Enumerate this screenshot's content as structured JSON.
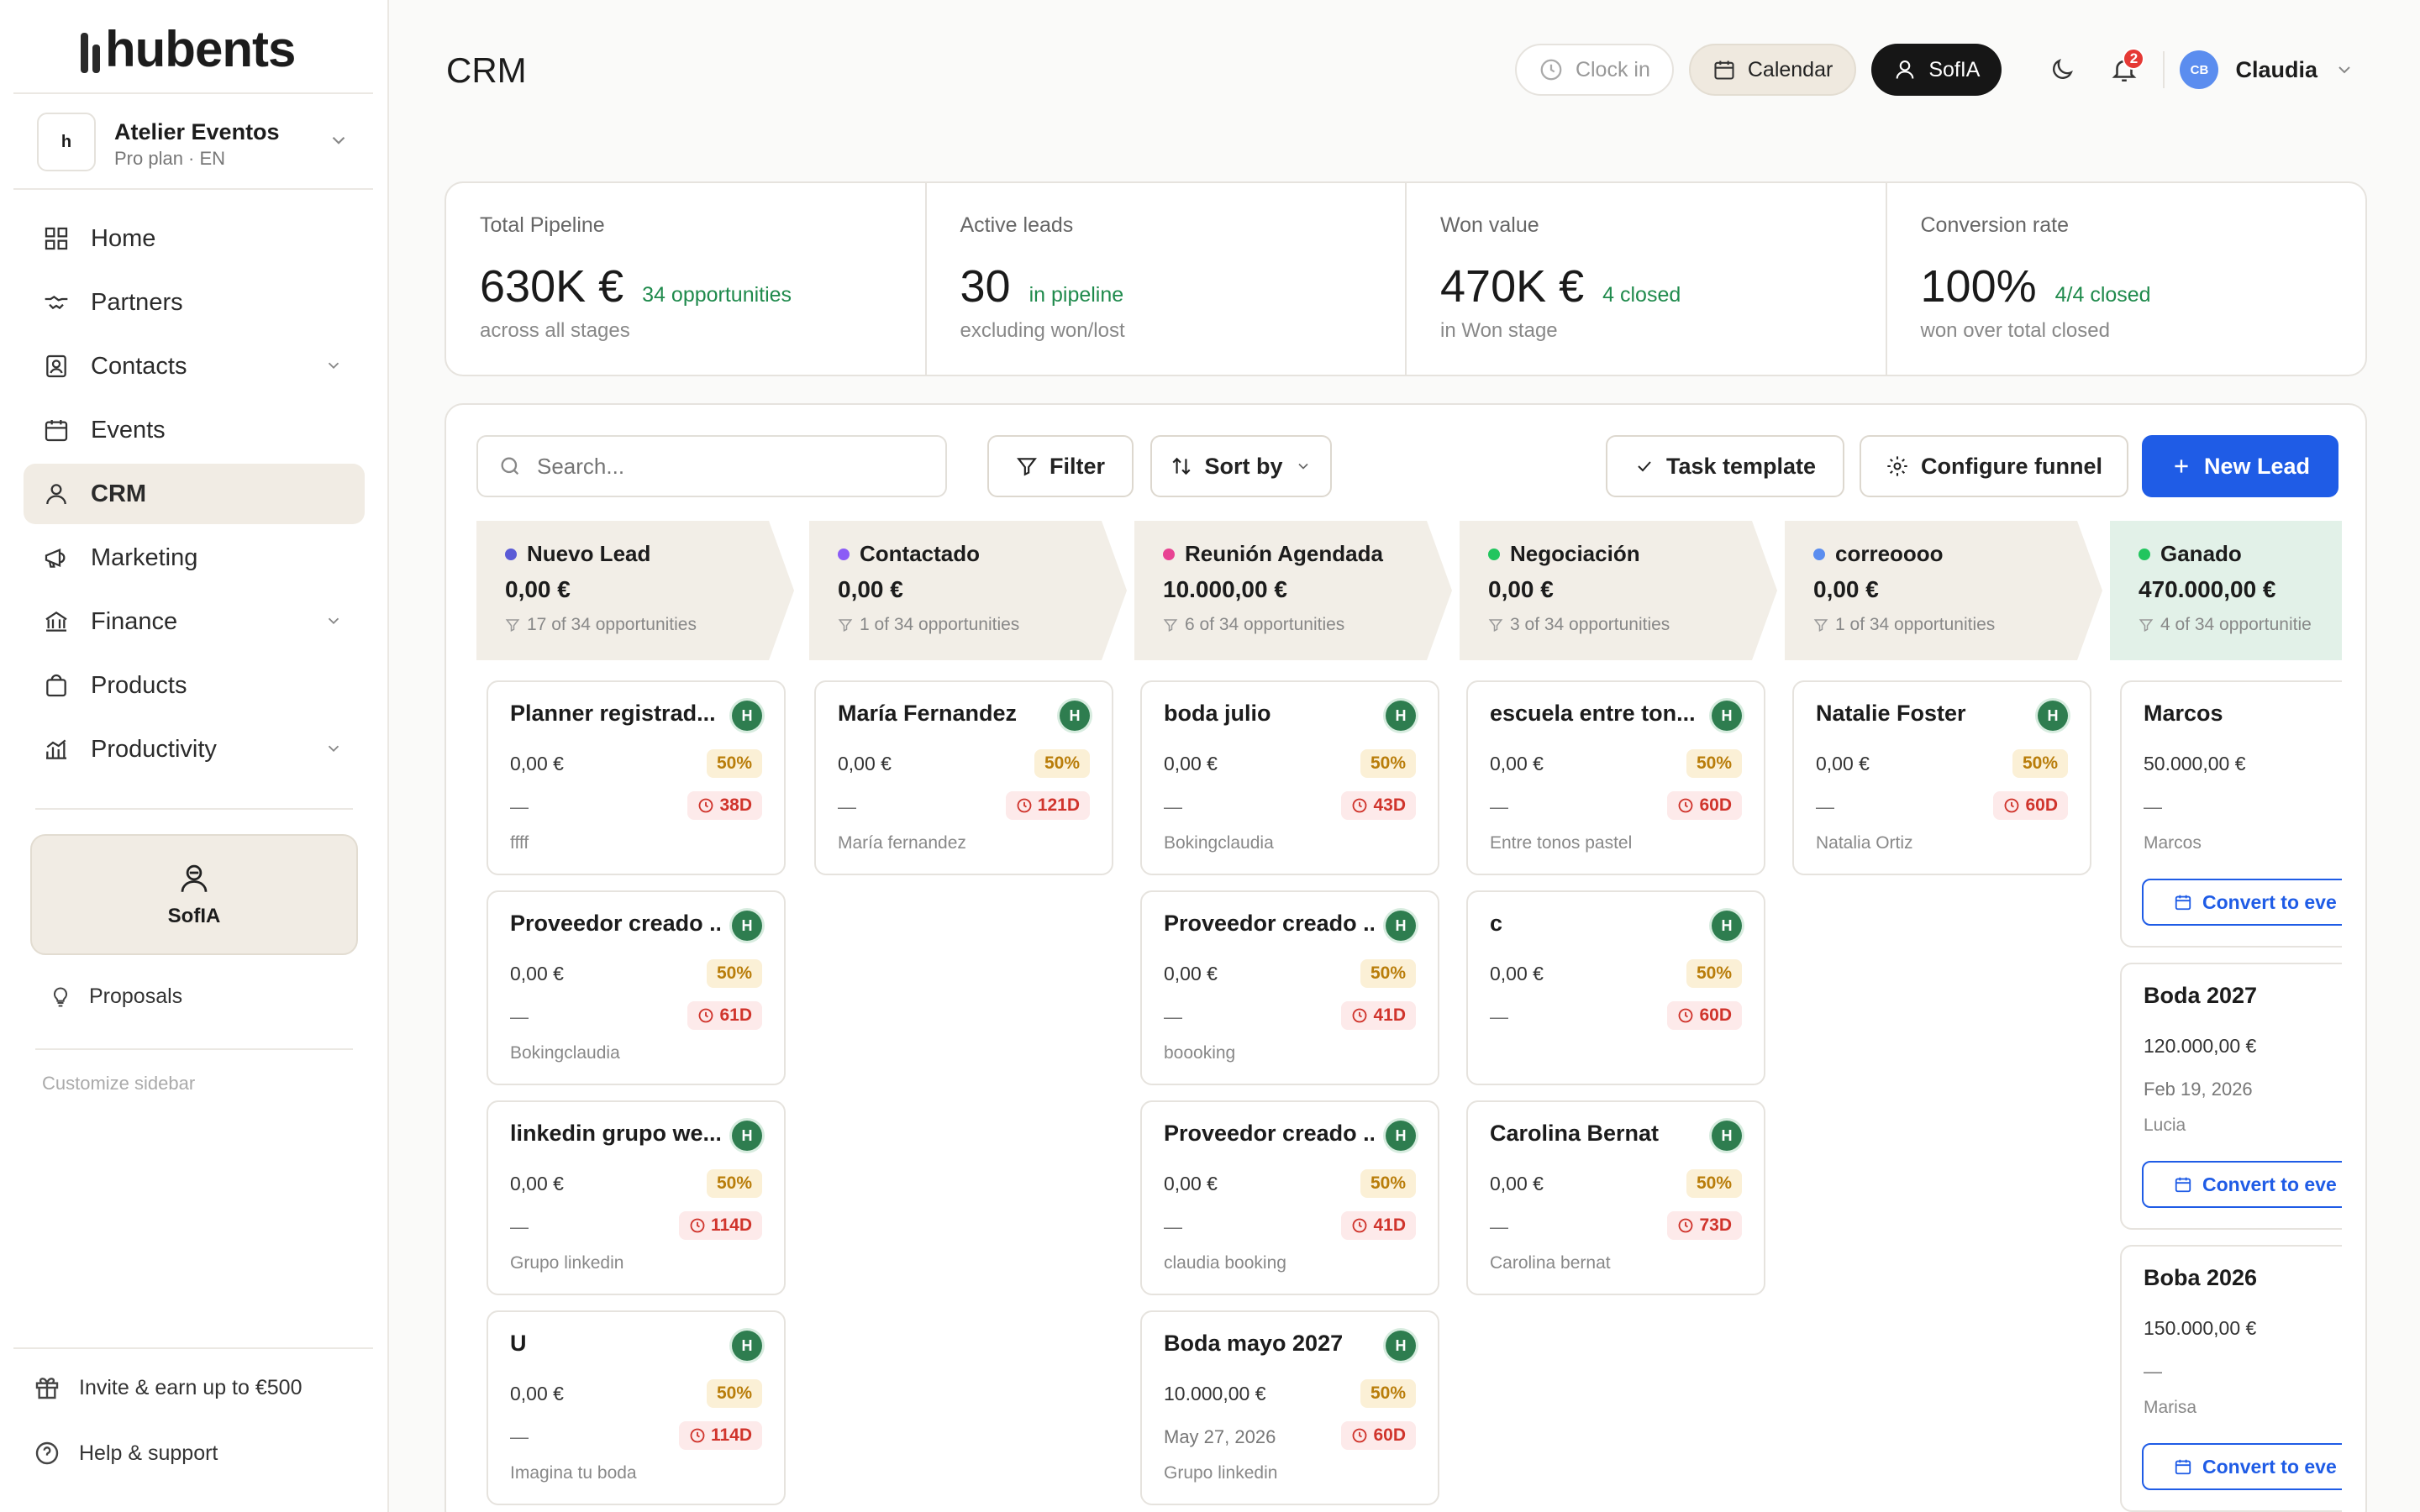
{
  "brand": {
    "name": "hubents"
  },
  "workspace": {
    "initial": "h",
    "name": "Atelier Eventos",
    "plan": "Pro plan · EN"
  },
  "nav": [
    {
      "label": "Home",
      "icon": "home-icon",
      "chevron": false,
      "active": false
    },
    {
      "label": "Partners",
      "icon": "handshake-icon",
      "chevron": false,
      "active": false
    },
    {
      "label": "Contacts",
      "icon": "contacts-icon",
      "chevron": true,
      "active": false
    },
    {
      "label": "Events",
      "icon": "calendar-icon",
      "chevron": false,
      "active": false
    },
    {
      "label": "CRM",
      "icon": "user-icon",
      "chevron": false,
      "active": true
    },
    {
      "label": "Marketing",
      "icon": "megaphone-icon",
      "chevron": false,
      "active": false
    },
    {
      "label": "Finance",
      "icon": "bank-icon",
      "chevron": true,
      "active": false
    },
    {
      "label": "Products",
      "icon": "bag-icon",
      "chevron": false,
      "active": false
    },
    {
      "label": "Productivity",
      "icon": "chart-icon",
      "chevron": true,
      "active": false
    }
  ],
  "sofia_panel": {
    "label": "SofIA"
  },
  "proposals": {
    "label": "Proposals"
  },
  "customize": {
    "label": "Customize sidebar"
  },
  "invite": {
    "label": "Invite & earn up to €500"
  },
  "help": {
    "label": "Help & support"
  },
  "header": {
    "title": "CRM",
    "clock_in": "Clock in",
    "calendar": "Calendar",
    "sofia": "SofIA",
    "notifications": "2",
    "user_initials": "CB",
    "user_name": "Claudia"
  },
  "stats": [
    {
      "label": "Total Pipeline",
      "value": "630K €",
      "accent": "34 opportunities",
      "sub": "across all stages"
    },
    {
      "label": "Active leads",
      "value": "30",
      "accent": "in pipeline",
      "sub": "excluding won/lost"
    },
    {
      "label": "Won value",
      "value": "470K €",
      "accent": "4 closed",
      "sub": "in Won stage"
    },
    {
      "label": "Conversion rate",
      "value": "100%",
      "accent": "4/4 closed",
      "sub": "won over total closed"
    }
  ],
  "toolbar": {
    "search_placeholder": "Search...",
    "filter": "Filter",
    "sort": "Sort by",
    "task_template": "Task template",
    "configure_funnel": "Configure funnel",
    "new_lead": "New Lead"
  },
  "colors": {
    "accent": "#1f5ce6",
    "green": "#1f8a4c",
    "danger": "#d0342c"
  },
  "stages": [
    {
      "name": "Nuevo Lead",
      "dot": "#5b5bd6",
      "value": "0,00 €",
      "count": "17 of 34 opportunities"
    },
    {
      "name": "Contactado",
      "dot": "#8b5cf6",
      "value": "0,00 €",
      "count": "1 of 34 opportunities"
    },
    {
      "name": "Reunión Agendada",
      "dot": "#e84393",
      "value": "10.000,00 €",
      "count": "6 of 34 opportunities"
    },
    {
      "name": "Negociación",
      "dot": "#22c55e",
      "value": "0,00 €",
      "count": "3 of 34 opportunities"
    },
    {
      "name": "correoooo",
      "dot": "#5b8def",
      "value": "0,00 €",
      "count": "1 of 34 opportunities"
    },
    {
      "name": "Ganado",
      "dot": "#22c55e",
      "value": "470.000,00 €",
      "count": "4 of 34 opportunitie"
    }
  ],
  "cards": [
    [
      {
        "title": "Planner registrad...",
        "amount": "0,00 €",
        "pct": "50%",
        "date": "—",
        "age": "38D",
        "contact": "ffff"
      },
      {
        "title": "Proveedor creado ...",
        "amount": "0,00 €",
        "pct": "50%",
        "date": "—",
        "age": "61D",
        "contact": "Bokingclaudia"
      },
      {
        "title": "linkedin grupo we...",
        "amount": "0,00 €",
        "pct": "50%",
        "date": "—",
        "age": "114D",
        "contact": "Grupo linkedin"
      },
      {
        "title": "U",
        "amount": "0,00 €",
        "pct": "50%",
        "date": "—",
        "age": "114D",
        "contact": "Imagina tu boda"
      }
    ],
    [
      {
        "title": "María Fernandez",
        "amount": "0,00 €",
        "pct": "50%",
        "date": "—",
        "age": "121D",
        "contact": "María fernandez"
      }
    ],
    [
      {
        "title": "boda julio",
        "amount": "0,00 €",
        "pct": "50%",
        "date": "—",
        "age": "43D",
        "contact": "Bokingclaudia"
      },
      {
        "title": "Proveedor creado ...",
        "amount": "0,00 €",
        "pct": "50%",
        "date": "—",
        "age": "41D",
        "contact": "boooking"
      },
      {
        "title": "Proveedor creado ...",
        "amount": "0,00 €",
        "pct": "50%",
        "date": "—",
        "age": "41D",
        "contact": "claudia booking"
      },
      {
        "title": "Boda mayo 2027",
        "amount": "10.000,00 €",
        "pct": "50%",
        "date": "May 27, 2026",
        "age": "60D",
        "contact": "Grupo linkedin"
      }
    ],
    [
      {
        "title": "escuela entre ton...",
        "amount": "0,00 €",
        "pct": "50%",
        "date": "—",
        "age": "60D",
        "contact": "Entre tonos pastel"
      },
      {
        "title": "c",
        "amount": "0,00 €",
        "pct": "50%",
        "date": "—",
        "age": "60D",
        "contact": ""
      },
      {
        "title": "Carolina Bernat",
        "amount": "0,00 €",
        "pct": "50%",
        "date": "—",
        "age": "73D",
        "contact": "Carolina bernat"
      }
    ],
    [
      {
        "title": "Natalie Foster",
        "amount": "0,00 €",
        "pct": "50%",
        "date": "—",
        "age": "60D",
        "contact": "Natalia Ortiz"
      }
    ],
    [
      {
        "title": "Marcos",
        "amount": "50.000,00 €",
        "pct": "",
        "date": "—",
        "age": "",
        "contact": "Marcos",
        "convert": "Convert to eve"
      },
      {
        "title": "Boda 2027",
        "amount": "120.000,00 €",
        "pct": "",
        "date": "Feb 19, 2026",
        "age": "",
        "contact": "Lucia",
        "convert": "Convert to eve"
      },
      {
        "title": "Boba 2026",
        "amount": "150.000,00 €",
        "pct": "",
        "date": "—",
        "age": "",
        "contact": "Marisa",
        "convert": "Convert to eve"
      }
    ]
  ]
}
